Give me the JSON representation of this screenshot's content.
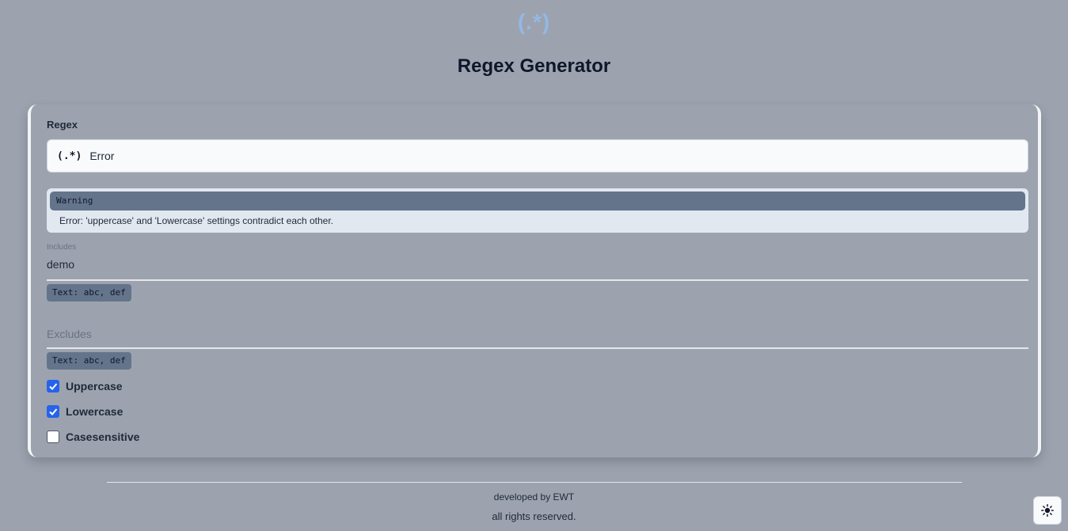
{
  "header": {
    "logo": "(.*)",
    "title": "Regex Generator"
  },
  "regex": {
    "label": "Regex",
    "icon": "(.*)",
    "value": "Error"
  },
  "warning": {
    "title": "Warning",
    "message": "Error: 'uppercase' and 'Lowercase' settings contradict each other."
  },
  "includes": {
    "caption": "Includes",
    "value": "demo",
    "hint": "Text: abc, def"
  },
  "excludes": {
    "placeholder": "Excludes",
    "value": "",
    "hint": "Text: abc, def"
  },
  "options": [
    {
      "label": "Uppercase",
      "checked": true
    },
    {
      "label": "Lowercase",
      "checked": true
    },
    {
      "label": "Casesensitive",
      "checked": false
    }
  ],
  "footer": {
    "developed_by": "developed by  EWT",
    "rights": "all rights reserved."
  },
  "theme_toggle": {
    "icon": "sun-icon"
  },
  "colors": {
    "accent": "#2563eb",
    "background": "#9ca3af",
    "logo": "#93b8e6",
    "warning_header": "#64748b"
  }
}
